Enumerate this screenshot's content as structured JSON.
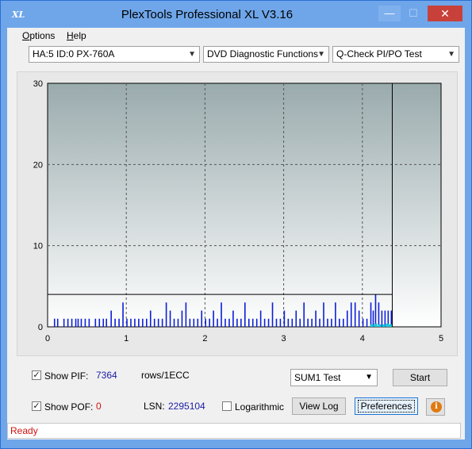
{
  "window": {
    "title": "PlexTools Professional XL V3.16",
    "icon_label": "XL",
    "minimize_symbol": "—",
    "maximize_symbol": "☐",
    "close_symbol": "✕"
  },
  "menu": {
    "items": [
      {
        "label": "Options",
        "underline": "O",
        "rest": "ptions"
      },
      {
        "label": "Help",
        "underline": "H",
        "rest": "elp"
      }
    ]
  },
  "toolbar": {
    "drive": "HA:5 ID:0  PX-760A",
    "function": "DVD Diagnostic Functions",
    "test": "Q-Check PI/PO Test"
  },
  "chart_data": {
    "type": "bar",
    "xlim": [
      0,
      5
    ],
    "ylim": [
      0,
      30
    ],
    "x_ticks": [
      "0",
      "1",
      "2",
      "3",
      "4",
      "5"
    ],
    "y_ticks": [
      "0",
      "10",
      "20",
      "30"
    ],
    "grid": true,
    "threshold_line": 4,
    "end_marker_x": 4.38,
    "series": [
      {
        "color": "#0b1fd6",
        "x": [
          0.08,
          0.12,
          0.2,
          0.25,
          0.3,
          0.35,
          0.38,
          0.42,
          0.47,
          0.52,
          0.6,
          0.65,
          0.7,
          0.74,
          0.8,
          0.85,
          0.9,
          0.95,
          1.0,
          1.05,
          1.1,
          1.15,
          1.2,
          1.25,
          1.3,
          1.35,
          1.4,
          1.45,
          1.5,
          1.55,
          1.6,
          1.65,
          1.7,
          1.75,
          1.8,
          1.85,
          1.9,
          1.95,
          2.0,
          2.05,
          2.1,
          2.15,
          2.2,
          2.25,
          2.3,
          2.35,
          2.4,
          2.45,
          2.5,
          2.55,
          2.6,
          2.65,
          2.7,
          2.75,
          2.8,
          2.85,
          2.9,
          2.95,
          3.0,
          3.05,
          3.1,
          3.15,
          3.2,
          3.25,
          3.3,
          3.35,
          3.4,
          3.45,
          3.5,
          3.55,
          3.6,
          3.65,
          3.7,
          3.75,
          3.8,
          3.85,
          3.9,
          3.95,
          4.0,
          4.05,
          4.1,
          4.13,
          4.16,
          4.2,
          4.24,
          4.28,
          4.32,
          4.36
        ],
        "values": [
          1,
          1,
          1,
          1,
          1,
          1,
          1,
          1,
          1,
          1,
          1,
          1,
          1,
          1,
          2,
          1,
          1,
          3,
          1,
          1,
          1,
          1,
          1,
          1,
          2,
          1,
          1,
          1,
          3,
          2,
          1,
          1,
          2,
          3,
          1,
          1,
          1,
          2,
          1,
          1,
          2,
          1,
          3,
          1,
          1,
          2,
          1,
          1,
          3,
          1,
          1,
          1,
          2,
          1,
          1,
          3,
          1,
          1,
          2,
          1,
          1,
          2,
          1,
          3,
          1,
          1,
          2,
          1,
          3,
          1,
          1,
          3,
          1,
          1,
          2,
          3,
          3,
          2,
          1,
          1,
          3,
          2,
          4,
          3,
          2,
          2,
          2,
          2
        ]
      },
      {
        "color": "#12c8d8",
        "x": [
          4.1,
          4.15,
          4.2,
          4.25,
          4.3,
          4.34
        ],
        "values": [
          0.3,
          0.4,
          0.3,
          0.3,
          0.4,
          0.3
        ]
      }
    ]
  },
  "controls": {
    "show_pif_label": "Show PIF:",
    "show_pif_checked": true,
    "pif_value": "7364",
    "rows_label": "rows/1ECC",
    "show_pof_label": "Show POF:",
    "show_pof_checked": true,
    "pof_value": "0",
    "lsn_label": "LSN:",
    "lsn_value": "2295104",
    "logarithmic_label": "Logarithmic",
    "logarithmic_checked": false,
    "sum_test": "SUM1 Test",
    "start_label": "Start",
    "view_log_label": "View Log",
    "preferences_label": "Preferences",
    "info_symbol": "i"
  },
  "status": {
    "text": "Ready",
    "color": "#d01010"
  }
}
